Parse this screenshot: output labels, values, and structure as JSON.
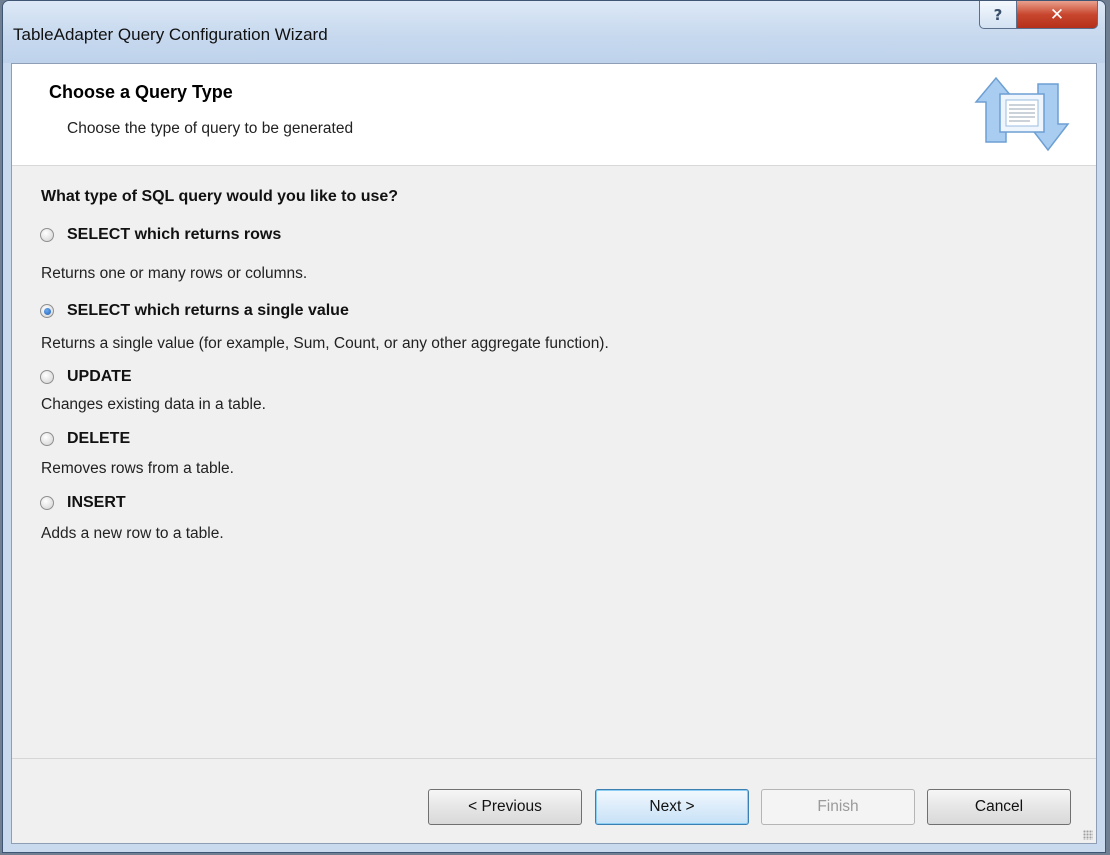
{
  "window": {
    "title": "TableAdapter Query Configuration Wizard",
    "help_glyph": "?",
    "close_glyph": "✕"
  },
  "header": {
    "title": "Choose a Query Type",
    "subtitle": "Choose the type of query to be generated",
    "icon": "query-arrows-icon"
  },
  "body": {
    "question": "What type of SQL query would you like to use?",
    "options": [
      {
        "label": "SELECT which returns rows",
        "description": "Returns one or many rows or columns.",
        "selected": false
      },
      {
        "label": "SELECT which returns a single value",
        "description": "Returns a single value (for example, Sum, Count, or any other aggregate function).",
        "selected": true
      },
      {
        "label": "UPDATE",
        "description": "Changes existing data in a table.",
        "selected": false
      },
      {
        "label": "DELETE",
        "description": "Removes rows from a table.",
        "selected": false
      },
      {
        "label": "INSERT",
        "description": "Adds a new row to a table.",
        "selected": false
      }
    ]
  },
  "footer": {
    "previous_label": "< Previous",
    "next_label": "Next >",
    "finish_label": "Finish",
    "cancel_label": "Cancel",
    "finish_enabled": false
  },
  "colors": {
    "close_button": "#c8462e",
    "radio_selected": "#1f5fb5",
    "icon_blue": "#7ab2e6"
  }
}
